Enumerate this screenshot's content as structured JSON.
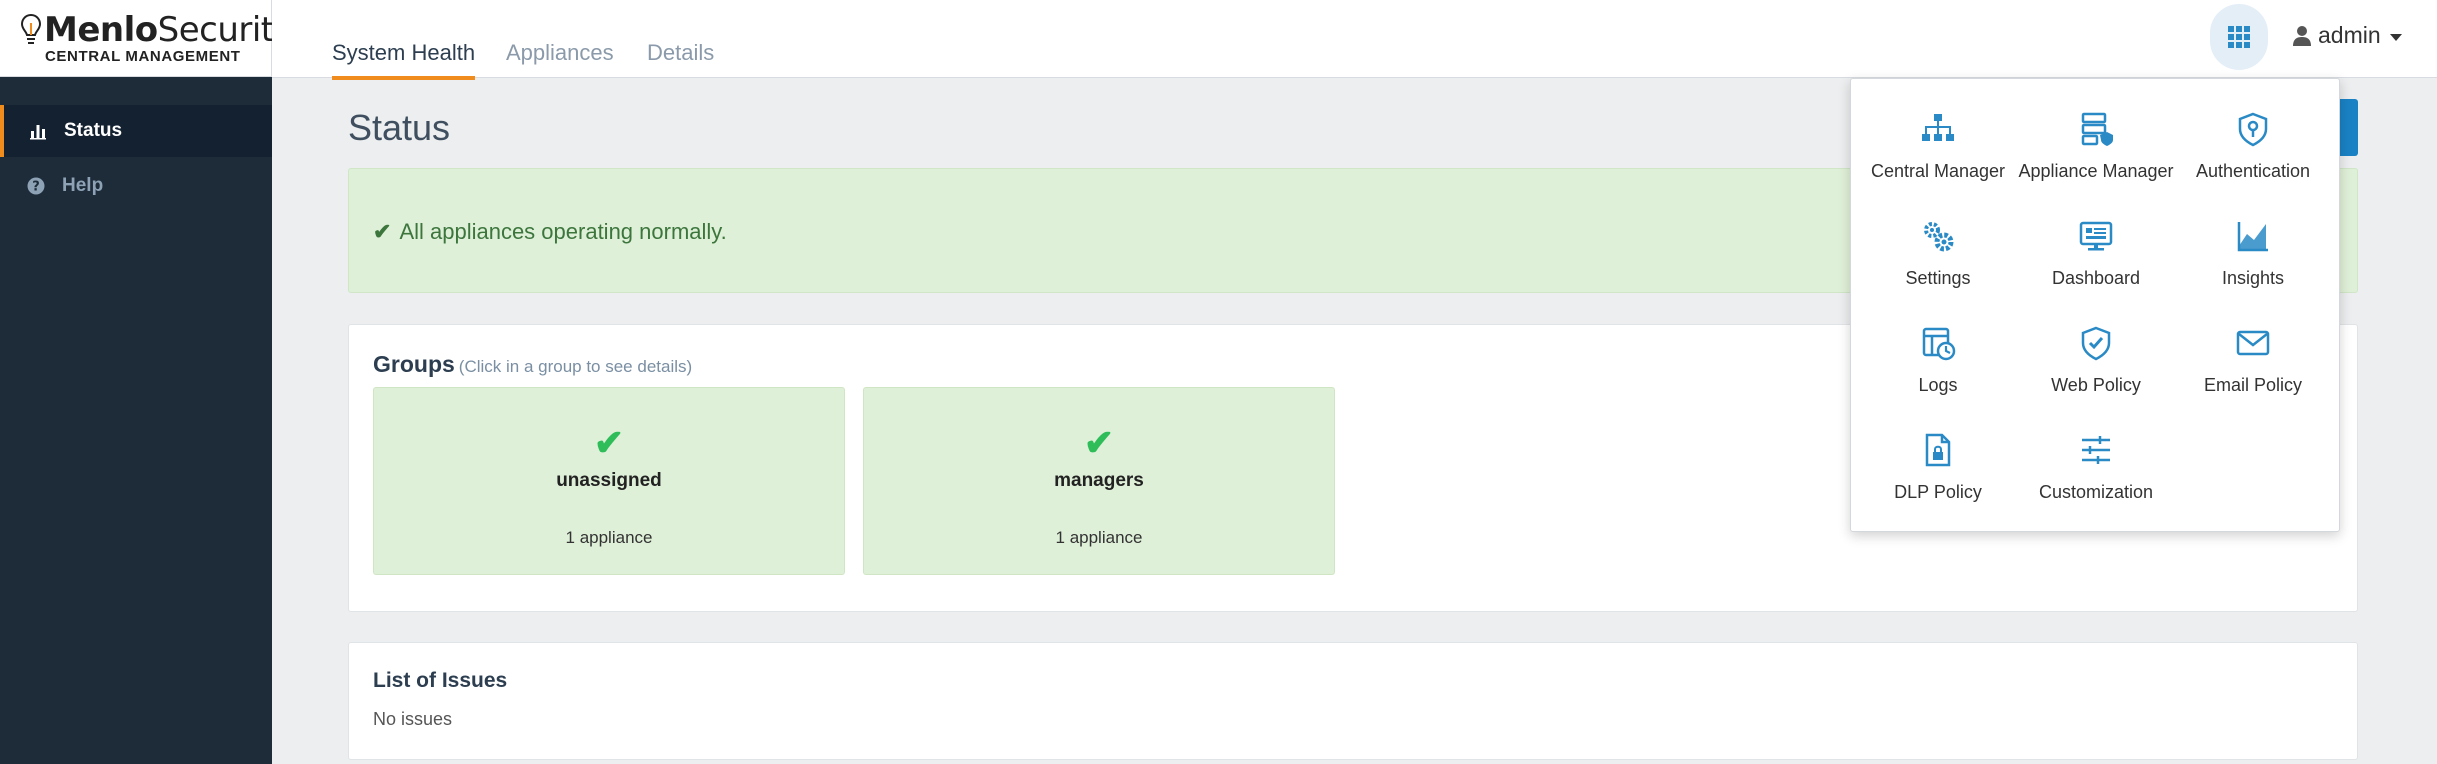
{
  "brand": {
    "name_bold": "Menlo",
    "name_light": "Security",
    "subtitle": "CENTRAL MANAGEMENT"
  },
  "sidebar": {
    "items": [
      {
        "label": "Status",
        "icon": "bar-chart-icon",
        "active": true
      },
      {
        "label": "Help",
        "icon": "question-circle-icon",
        "active": false
      }
    ]
  },
  "header": {
    "tabs": [
      {
        "label": "System Health",
        "active": true
      },
      {
        "label": "Appliances",
        "active": false
      },
      {
        "label": "Details",
        "active": false
      }
    ],
    "user": "admin"
  },
  "main": {
    "title": "Status",
    "alert": "All appliances operating normally.",
    "groups": {
      "title": "Groups",
      "hint": "(Click in a group to see details)",
      "cards": [
        {
          "name": "unassigned",
          "count": "1 appliance"
        },
        {
          "name": "managers",
          "count": "1 appliance"
        }
      ]
    },
    "issues": {
      "title": "List of Issues",
      "empty": "No issues"
    }
  },
  "apps_menu": {
    "items": [
      {
        "label": "Central Manager",
        "icon": "sitemap-icon"
      },
      {
        "label": "Appliance Manager",
        "icon": "server-shield-icon"
      },
      {
        "label": "Authentication",
        "icon": "shield-key-icon"
      },
      {
        "label": "Settings",
        "icon": "gears-icon"
      },
      {
        "label": "Dashboard",
        "icon": "monitor-icon"
      },
      {
        "label": "Insights",
        "icon": "area-chart-icon"
      },
      {
        "label": "Logs",
        "icon": "log-clock-icon"
      },
      {
        "label": "Web Policy",
        "icon": "shield-check-icon"
      },
      {
        "label": "Email Policy",
        "icon": "envelope-icon"
      },
      {
        "label": "DLP Policy",
        "icon": "file-lock-icon"
      },
      {
        "label": "Customization",
        "icon": "sliders-icon"
      }
    ]
  },
  "colors": {
    "accent": "#f08c1d",
    "icon_blue": "#2a8ac6",
    "success_bg": "#dff0d8",
    "success_text": "#3c763d",
    "sidebar_bg": "#1e2c3a"
  }
}
